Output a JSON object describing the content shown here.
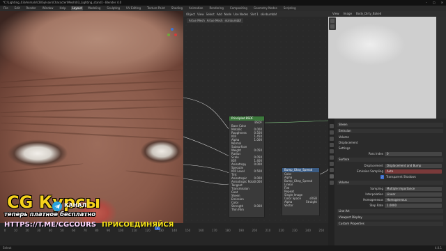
{
  "titlebar": {
    "text": "*C:\\Lighting_03\\Animals\\CB\\Sylvain\\Character\\Mesh\\03_Lighting_stand] - Blender 4.0",
    "controls": [
      "–",
      "□",
      "✕"
    ]
  },
  "workspaces": [
    {
      "label": "File"
    },
    {
      "label": "Edit"
    },
    {
      "label": "Render"
    },
    {
      "label": "Window"
    },
    {
      "label": "Help"
    },
    {
      "label": "Layout"
    },
    {
      "label": "Modeling"
    },
    {
      "label": "Sculpting"
    },
    {
      "label": "UV Editing"
    },
    {
      "label": "Texture Paint"
    },
    {
      "label": "Shading"
    },
    {
      "label": "Animation"
    },
    {
      "label": "Rendering"
    },
    {
      "label": "Compositing"
    },
    {
      "label": "Geometry Nodes"
    },
    {
      "label": "Scripting"
    }
  ],
  "active_workspace": "Layout",
  "node_editor": {
    "header": [
      "Object",
      "View",
      "Select",
      "Add",
      "Node",
      "Use Nodes",
      "Slot 1",
      "skinbumbbf"
    ],
    "breadcrumb": [
      "Artue Mesh",
      "Artue Mesh",
      "skinbumbbf"
    ],
    "principled": {
      "title": "Principled BSDF",
      "output": "BSDF",
      "rows": [
        "Base Color",
        "Metallic",
        "Roughness",
        "IOR",
        "Alpha",
        "Normal",
        "Subsurface",
        "Weight",
        "Radius",
        "Scale",
        "IOR",
        "Anisotropy",
        "Specular",
        "IOR Level",
        "Tint",
        "Anisotropic",
        "Anisotropic Rotation",
        "Tangent",
        "Transmission",
        "Coat",
        "Sheen",
        "Emission",
        "Color",
        "Strength",
        "Thin Film"
      ],
      "values": [
        "",
        "0.000",
        "0.500",
        "1.450",
        "1.000",
        "",
        "",
        "0.050",
        "",
        "0.050",
        "1.400",
        "0.000",
        "",
        "0.500",
        "",
        "0.000",
        "0.000",
        "",
        "",
        "",
        "",
        "",
        "",
        "0.000",
        ""
      ]
    },
    "node2": {
      "title": "Bump_Ghay_Spread",
      "rows": [
        "Color",
        "Alpha",
        "Bump_Ghay_Spread",
        "Linear",
        "Flat",
        "Repeat",
        "Single Image",
        "Color Space",
        "Alpha",
        "Vector"
      ],
      "values": [
        "",
        "",
        "",
        "",
        "",
        "",
        "",
        "sRGB",
        "Straight",
        ""
      ]
    }
  },
  "image_editor": {
    "header": [
      "View",
      "Image",
      "Body_Dirty_Baked"
    ],
    "tools": [
      "pen-icon",
      "pen-icon-2"
    ]
  },
  "properties": {
    "rows": [
      {
        "label": "Sheen",
        "type": "panel"
      },
      {
        "label": "Emission",
        "type": "panel"
      },
      {
        "label": "Volume",
        "type": "section"
      },
      {
        "label": "Displacement",
        "type": "section"
      },
      {
        "label": "Settings",
        "type": "section"
      },
      {
        "label": "Pass Index",
        "type": "field",
        "value": "0"
      },
      {
        "label": "Surface",
        "type": "panel"
      },
      {
        "label": "Displacement",
        "type": "field",
        "value": "Displacement and Bump"
      },
      {
        "label": "Emission Sampling",
        "type": "field",
        "value": "Auto"
      },
      {
        "label": "Transparent Shadows",
        "type": "check",
        "value": "✓"
      },
      {
        "label": "Volume",
        "type": "panel"
      },
      {
        "label": "Sampling",
        "type": "field",
        "value": "Multiple Importance"
      },
      {
        "label": "Interpolation",
        "type": "field",
        "value": "Linear"
      },
      {
        "label": "Homogeneous",
        "type": "field",
        "value": "Homogeneous"
      },
      {
        "label": "Step Rate",
        "type": "field",
        "value": "1.0000"
      },
      {
        "label": "Line Art",
        "type": "panel"
      },
      {
        "label": "Viewport Display",
        "type": "panel"
      },
      {
        "label": "Custom Properties",
        "type": "panel"
      }
    ]
  },
  "timeline": {
    "ticks": [
      "0",
      "10",
      "20",
      "30",
      "40",
      "50",
      "60",
      "70",
      "80",
      "90",
      "100",
      "110",
      "120",
      "130",
      "140",
      "150",
      "160",
      "170",
      "180",
      "190",
      "200",
      "210",
      "220",
      "230",
      "240",
      "250"
    ],
    "current_frame": "1"
  },
  "statusbar": {
    "left": "Select",
    "right": "4.0.1"
  },
  "ad": {
    "title": "CG Курсы",
    "channel": "КАНАЛ",
    "subtitle": "теперь платное бесплатно",
    "url": "HTTPS://T.ME/CGCOURS",
    "join": "ПРИСОЕДИНЯЙСЯ"
  },
  "colors": {
    "accent": "#3d6fd0",
    "node_header": "#3c7a3c",
    "node2_header": "#3b5c84",
    "ad_yellow": "#f7d21c",
    "telegram": "#2aa3e0"
  }
}
